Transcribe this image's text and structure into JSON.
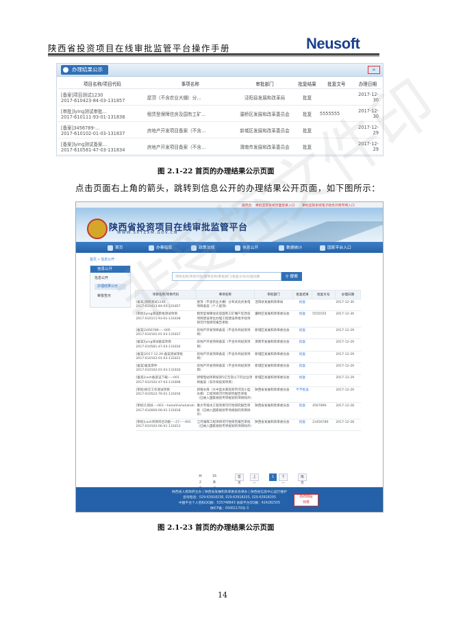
{
  "doc": {
    "header_title": "陕西省投资项目在线审批监管平台操作手册",
    "logo": "Neusoft",
    "page_number": "14"
  },
  "figure1": {
    "panel_title": "办理结果公示",
    "arrow_glyph": "»",
    "columns": [
      "项目名称/项目代码",
      "事项名称",
      "审批部门",
      "批复结果",
      "批复文号",
      "办理日期"
    ],
    "rows": [
      {
        "name": "[备案]项目测试1230",
        "code": "2017-610423-84-03-131857",
        "item": "屋顶（不含农业大棚）分...",
        "dept": "泾阳县发展和改革局",
        "result": "批复",
        "doc_no": "",
        "date": "2017-12-30"
      },
      {
        "name": "[审批]lying测试审批...",
        "code": "2017-610111-93-01-131838",
        "item": "租赁型保障住房及国有工矿...",
        "dept": "灞桥区发展和改革委员会",
        "result": "批复",
        "doc_no": "5555555",
        "date": "2017-12-30"
      },
      {
        "name": "[备案]3456789-...",
        "code": "2017-610102-01-03-131837",
        "item": "房地产开发项目备案（不含...",
        "dept": "新城区发展和改革委员会",
        "result": "批复",
        "doc_no": "",
        "date": "2017-12-29"
      },
      {
        "name": "[备案]lying测试备案...",
        "code": "2017-610581-47-03-131834",
        "item": "房地产开发项目备案（不含...",
        "dept": "渭南市发展和改革委员会",
        "result": "批复",
        "doc_no": "",
        "date": "2017-12-29"
      }
    ],
    "caption": "图 2.1-22  首页的办理结果公示页面"
  },
  "body_text": "点击页面右上角的箭头，跳转到信息公开的办理结果公开页面，如下图所示：",
  "figure2": {
    "top_links": [
      "国平台",
      "审批监管系统页面登录入口",
      "审批监管系统电子政务外网专网入口"
    ],
    "site_title": "陕西省投资项目在线审批监管平台",
    "site_url": "WWW.SXTZXM.GOV.CN",
    "nav": [
      "首页",
      "办事指南",
      "政策法规",
      "信息公开",
      "数据统计",
      "国家平台入口"
    ],
    "breadcrumb": "首页 » 信息公开",
    "sidebar": {
      "head": "信息公开",
      "items": [
        "信息公开",
        "办理结果公示",
        "审批告示"
      ]
    },
    "search_placeholder": "项目名称/项目代码/事项名称/审批部门/批复文号/办理日期",
    "search_button": "搜索",
    "columns": [
      "项目名称/项目代码",
      "事项名称",
      "审批部门",
      "批复结果",
      "批复文号",
      "办理日期"
    ],
    "rows": [
      {
        "name": "[备案]项目测试1230",
        "code": "2017-610423-84-03-131857",
        "item": "屋顶（不含农业大棚）分布式光伏发电项目备案（个人屋顶）",
        "dept": "泾阳县发展和改革局",
        "result": "批复",
        "doc_no": "",
        "date": "2017-12-30"
      },
      {
        "name": "[审批]lying测试审批测试项目",
        "code": "2017-610111-93-01-131838",
        "item": "租赁型保障住房及国有工矿棚户区改造项目建设单位办理工程建设审批手续项目可行性研究报告审批",
        "dept": "灞桥区发展和改革委员会",
        "result": "批复",
        "doc_no": "5555555",
        "date": "2017-12-30"
      },
      {
        "name": "[备案]3456789-----005",
        "code": "2017-610102-01-03-131837",
        "item": "房地产开发项目备案（不含外商投资项目）",
        "dept": "新城区发展和改革委员会",
        "result": "批复",
        "doc_no": "",
        "date": "2017-12-29"
      },
      {
        "name": "[备案]lying测试备案项目",
        "code": "2017-610581-47-03-131834",
        "item": "房地产开发项目备案（不含外商投资项目）",
        "dept": "渭南市发展和改革委员会",
        "result": "批复",
        "doc_no": "",
        "date": "2017-12-29"
      },
      {
        "name": "[备案]2017-12-29-备案测试审批",
        "code": "2017-610102-01-03-131831",
        "item": "房地产开发项目备案（不含外商投资项目）",
        "dept": "新城区发展和改革委员会",
        "result": "批复",
        "doc_no": "",
        "date": "2017-12-29"
      },
      {
        "name": "[备案]备案审件",
        "code": "2017-610102-01-03-131830",
        "item": "房地产开发项目备案（不含外商投资项目）",
        "dept": "新城区发展和改革委员会",
        "result": "批复",
        "doc_no": "",
        "date": "2017-12-29"
      },
      {
        "name": "[备案]cash备案证下载-----001",
        "code": "2017-610102-47-03-131808",
        "item": "新增电站项目投资5亿元及以下的企业项目备案（非外商投资项目）",
        "dept": "新城区发展和改革委员会",
        "result": "批复",
        "doc_no": "",
        "date": "2017-12-29"
      },
      {
        "name": "[审批]拆迁工作测试项目",
        "code": "2017-610522-76-01-131816",
        "item": "新增水库（大中型水库及跨市河流小型水库）工程项目可行性研究报告审批（已纳入国家规划专项规划的项目除外）",
        "dept": "陕西省发展和改革委员会",
        "result": "不予批准",
        "doc_no": "",
        "date": "2017-12-29"
      },
      {
        "name": "[审批]1测试----001---hahahhahahahah",
        "code": "2017-610000-06-01-131818",
        "item": "重大市域水工程项目可行性研究报告审批（已纳入国家规划专项规划的项目除外）",
        "dept": "陕西省发展和改革委员会",
        "result": "批复",
        "doc_no": "4567890",
        "date": "2017-12-28"
      },
      {
        "name": "[审批]cash项目综合功能----27-----001",
        "code": "2017-610102-06-01-131813",
        "item": "江河湖库工程项目可行性研究报告审批（已纳入国家规划专项规划的项目除外）",
        "dept": "陕西省发展和改革委员会",
        "result": "批复",
        "doc_no": "23456789",
        "date": "2017-12-28"
      }
    ],
    "pager": {
      "total": "共2页",
      "per_page": "16条记录",
      "first": "首页",
      "prev": "上一页",
      "current": "1",
      "next": "下一页",
      "last": "尾页"
    },
    "footer": [
      "陕西省人民政府主办 | 陕西省发展和改革委员会承办 | 陕西省信息中心运行维护",
      "咨询电话：029-63918236, 029-63918203, 029-63918205",
      "中国平台个人密码QQ群：535748843   省级平台QQ群：424282505",
      "陕ICP备：05001170号-3"
    ],
    "footer_badge": [
      "政府网站",
      "找错"
    ],
    "caption": "图 2.1-23  首页的办理结果公示页面"
  },
  "watermark": "非受控文件印"
}
